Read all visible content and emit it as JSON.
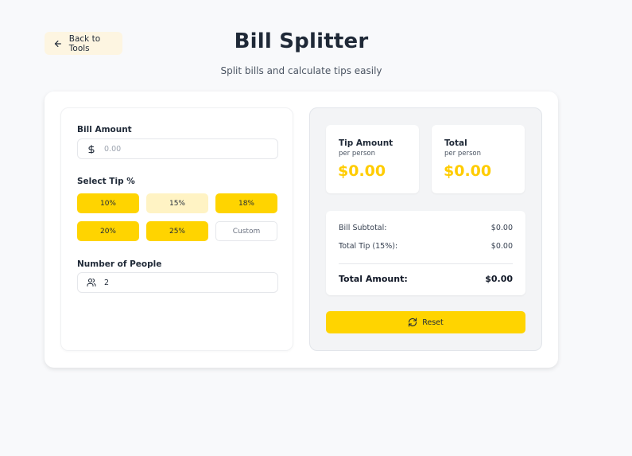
{
  "header": {
    "back_label": "Back to Tools",
    "title": "Bill Splitter",
    "subtitle": "Split bills and calculate tips easily"
  },
  "form": {
    "bill_label": "Bill Amount",
    "bill_placeholder": "0.00",
    "tip_label": "Select Tip %",
    "tips": [
      "10%",
      "15%",
      "18%",
      "20%",
      "25%"
    ],
    "selected_tip": "15%",
    "custom_placeholder": "Custom",
    "people_label": "Number of People",
    "people_value": "2"
  },
  "results": {
    "tip_title": "Tip Amount",
    "tip_sub": "per person",
    "tip_value": "$0.00",
    "total_title": "Total",
    "total_sub": "per person",
    "total_value": "$0.00",
    "subtotal_label": "Bill Subtotal:",
    "subtotal_value": "$0.00",
    "total_tip_label": "Total Tip (15%):",
    "total_tip_value": "$0.00",
    "total_amount_label": "Total Amount:",
    "total_amount_value": "$0.00",
    "reset_label": "Reset"
  },
  "colors": {
    "accent": "#ffd400",
    "accent_light": "#fff3c4",
    "amount_text": "#ffcc00"
  },
  "icons": [
    "arrow-left-icon",
    "dollar-icon",
    "users-icon",
    "refresh-icon"
  ]
}
